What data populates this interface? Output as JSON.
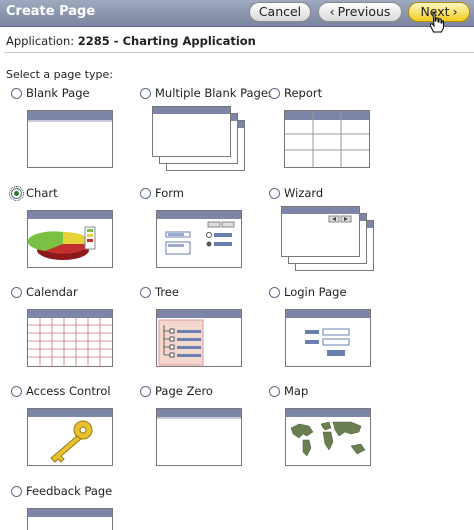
{
  "header": {
    "title": "Create Page",
    "cancel_label": "Cancel",
    "previous_label": "Previous",
    "next_label": "Next"
  },
  "application": {
    "label": "Application:",
    "value": "2285 - Charting Application"
  },
  "prompt": "Select a page type:",
  "page_types": [
    {
      "label": "Blank Page",
      "selected": false
    },
    {
      "label": "Multiple Blank Pages",
      "selected": false
    },
    {
      "label": "Report",
      "selected": false
    },
    {
      "label": "Chart",
      "selected": true
    },
    {
      "label": "Form",
      "selected": false
    },
    {
      "label": "Wizard",
      "selected": false
    },
    {
      "label": "Calendar",
      "selected": false
    },
    {
      "label": "Tree",
      "selected": false
    },
    {
      "label": "Login Page",
      "selected": false
    },
    {
      "label": "Access Control",
      "selected": false
    },
    {
      "label": "Page Zero",
      "selected": false
    },
    {
      "label": "Map",
      "selected": false
    },
    {
      "label": "Feedback Page",
      "selected": false
    }
  ]
}
